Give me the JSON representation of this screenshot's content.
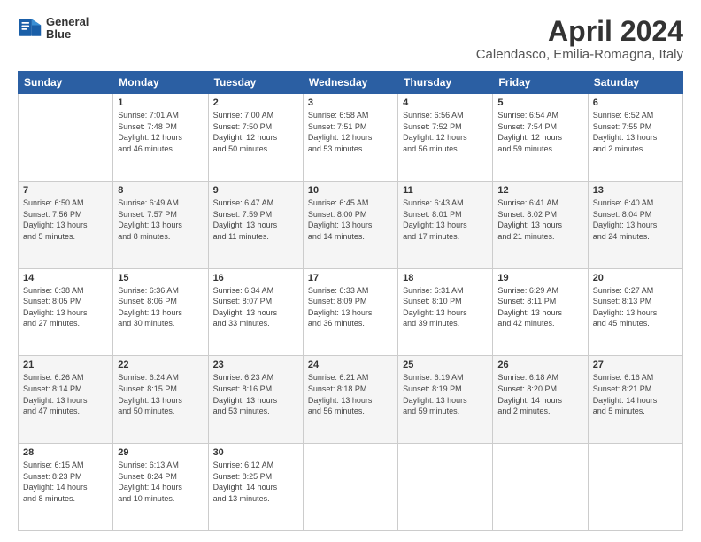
{
  "header": {
    "logo_line1": "General",
    "logo_line2": "Blue",
    "title": "April 2024",
    "subtitle": "Calendasco, Emilia-Romagna, Italy"
  },
  "weekdays": [
    "Sunday",
    "Monday",
    "Tuesday",
    "Wednesday",
    "Thursday",
    "Friday",
    "Saturday"
  ],
  "weeks": [
    [
      {
        "day": "",
        "info": ""
      },
      {
        "day": "1",
        "info": "Sunrise: 7:01 AM\nSunset: 7:48 PM\nDaylight: 12 hours\nand 46 minutes."
      },
      {
        "day": "2",
        "info": "Sunrise: 7:00 AM\nSunset: 7:50 PM\nDaylight: 12 hours\nand 50 minutes."
      },
      {
        "day": "3",
        "info": "Sunrise: 6:58 AM\nSunset: 7:51 PM\nDaylight: 12 hours\nand 53 minutes."
      },
      {
        "day": "4",
        "info": "Sunrise: 6:56 AM\nSunset: 7:52 PM\nDaylight: 12 hours\nand 56 minutes."
      },
      {
        "day": "5",
        "info": "Sunrise: 6:54 AM\nSunset: 7:54 PM\nDaylight: 12 hours\nand 59 minutes."
      },
      {
        "day": "6",
        "info": "Sunrise: 6:52 AM\nSunset: 7:55 PM\nDaylight: 13 hours\nand 2 minutes."
      }
    ],
    [
      {
        "day": "7",
        "info": "Sunrise: 6:50 AM\nSunset: 7:56 PM\nDaylight: 13 hours\nand 5 minutes."
      },
      {
        "day": "8",
        "info": "Sunrise: 6:49 AM\nSunset: 7:57 PM\nDaylight: 13 hours\nand 8 minutes."
      },
      {
        "day": "9",
        "info": "Sunrise: 6:47 AM\nSunset: 7:59 PM\nDaylight: 13 hours\nand 11 minutes."
      },
      {
        "day": "10",
        "info": "Sunrise: 6:45 AM\nSunset: 8:00 PM\nDaylight: 13 hours\nand 14 minutes."
      },
      {
        "day": "11",
        "info": "Sunrise: 6:43 AM\nSunset: 8:01 PM\nDaylight: 13 hours\nand 17 minutes."
      },
      {
        "day": "12",
        "info": "Sunrise: 6:41 AM\nSunset: 8:02 PM\nDaylight: 13 hours\nand 21 minutes."
      },
      {
        "day": "13",
        "info": "Sunrise: 6:40 AM\nSunset: 8:04 PM\nDaylight: 13 hours\nand 24 minutes."
      }
    ],
    [
      {
        "day": "14",
        "info": "Sunrise: 6:38 AM\nSunset: 8:05 PM\nDaylight: 13 hours\nand 27 minutes."
      },
      {
        "day": "15",
        "info": "Sunrise: 6:36 AM\nSunset: 8:06 PM\nDaylight: 13 hours\nand 30 minutes."
      },
      {
        "day": "16",
        "info": "Sunrise: 6:34 AM\nSunset: 8:07 PM\nDaylight: 13 hours\nand 33 minutes."
      },
      {
        "day": "17",
        "info": "Sunrise: 6:33 AM\nSunset: 8:09 PM\nDaylight: 13 hours\nand 36 minutes."
      },
      {
        "day": "18",
        "info": "Sunrise: 6:31 AM\nSunset: 8:10 PM\nDaylight: 13 hours\nand 39 minutes."
      },
      {
        "day": "19",
        "info": "Sunrise: 6:29 AM\nSunset: 8:11 PM\nDaylight: 13 hours\nand 42 minutes."
      },
      {
        "day": "20",
        "info": "Sunrise: 6:27 AM\nSunset: 8:13 PM\nDaylight: 13 hours\nand 45 minutes."
      }
    ],
    [
      {
        "day": "21",
        "info": "Sunrise: 6:26 AM\nSunset: 8:14 PM\nDaylight: 13 hours\nand 47 minutes."
      },
      {
        "day": "22",
        "info": "Sunrise: 6:24 AM\nSunset: 8:15 PM\nDaylight: 13 hours\nand 50 minutes."
      },
      {
        "day": "23",
        "info": "Sunrise: 6:23 AM\nSunset: 8:16 PM\nDaylight: 13 hours\nand 53 minutes."
      },
      {
        "day": "24",
        "info": "Sunrise: 6:21 AM\nSunset: 8:18 PM\nDaylight: 13 hours\nand 56 minutes."
      },
      {
        "day": "25",
        "info": "Sunrise: 6:19 AM\nSunset: 8:19 PM\nDaylight: 13 hours\nand 59 minutes."
      },
      {
        "day": "26",
        "info": "Sunrise: 6:18 AM\nSunset: 8:20 PM\nDaylight: 14 hours\nand 2 minutes."
      },
      {
        "day": "27",
        "info": "Sunrise: 6:16 AM\nSunset: 8:21 PM\nDaylight: 14 hours\nand 5 minutes."
      }
    ],
    [
      {
        "day": "28",
        "info": "Sunrise: 6:15 AM\nSunset: 8:23 PM\nDaylight: 14 hours\nand 8 minutes."
      },
      {
        "day": "29",
        "info": "Sunrise: 6:13 AM\nSunset: 8:24 PM\nDaylight: 14 hours\nand 10 minutes."
      },
      {
        "day": "30",
        "info": "Sunrise: 6:12 AM\nSunset: 8:25 PM\nDaylight: 14 hours\nand 13 minutes."
      },
      {
        "day": "",
        "info": ""
      },
      {
        "day": "",
        "info": ""
      },
      {
        "day": "",
        "info": ""
      },
      {
        "day": "",
        "info": ""
      }
    ]
  ]
}
